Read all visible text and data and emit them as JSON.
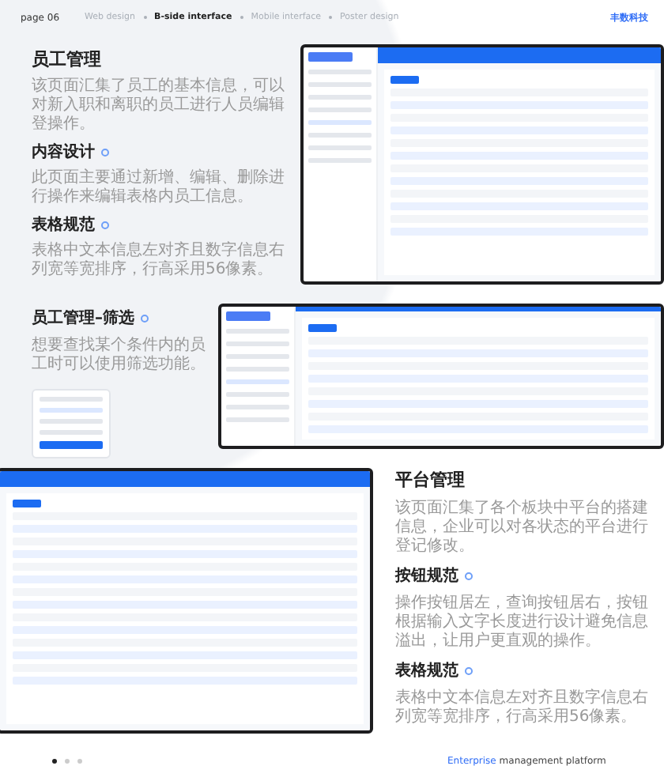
{
  "header": {
    "page": "page 06",
    "nav": [
      {
        "label": "Web design",
        "selected": false
      },
      {
        "label": "B-side interface",
        "selected": true
      },
      {
        "label": "Mobile interface",
        "selected": false
      },
      {
        "label": "Poster design",
        "selected": false
      }
    ],
    "logo": "丰数科技"
  },
  "employee": {
    "title": "员工管理",
    "desc": "该页面汇集了员工的基本信息，可以对新入职和离职的员工进行人员编辑登操作。",
    "points": [
      {
        "title": "内容设计",
        "desc": "此页面主要通过新增、编辑、删除进行操作来编辑表格内员工信息。"
      },
      {
        "title": "表格规范",
        "desc": "表格中文本信息左对齐且数字信息右列宽等宽排序，行高采用56像素。"
      }
    ]
  },
  "filter": {
    "title": "员工管理–筛选",
    "desc": "想要查找某个条件内的员工时可以使用筛选功能。"
  },
  "platform": {
    "title": "平台管理",
    "desc": "该页面汇集了各个板块中平台的搭建信息，企业可以对各状态的平台进行登记修改。",
    "points": [
      {
        "title": "按钮规范",
        "desc": "操作按钮居左，查询按钮居右，按钮根据输入文字长度进行设计避免信息溢出，让用户更直观的操作。"
      },
      {
        "title": "表格规范",
        "desc": "表格中文本信息左对齐且数字信息右列宽等宽排序，行高采用56像素。"
      }
    ]
  },
  "footer": {
    "dots": [
      {
        "selected": true
      },
      {
        "selected": false
      },
      {
        "selected": false
      }
    ],
    "highlight": "Enterprise",
    "rest": "management platform"
  }
}
